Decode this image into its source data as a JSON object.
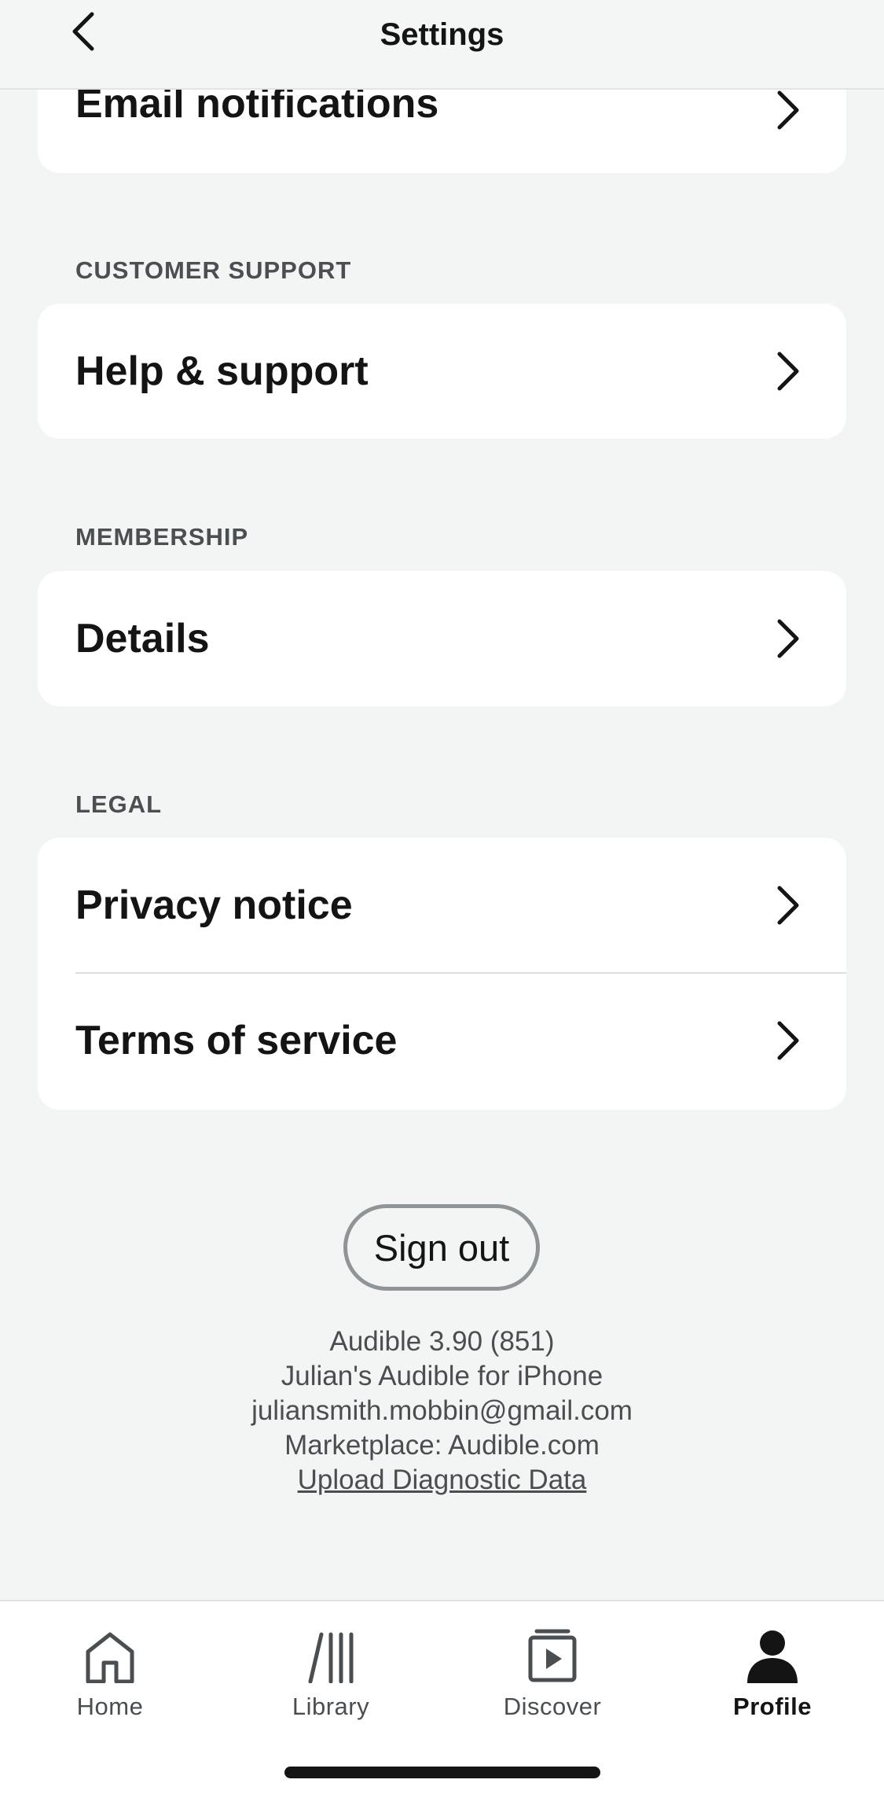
{
  "header": {
    "title": "Settings",
    "back_icon": "chevron-left-icon"
  },
  "sections": {
    "notifications": {
      "email_label": "Email notifications"
    },
    "customer_support": {
      "heading": "CUSTOMER SUPPORT",
      "help_label": "Help & support"
    },
    "membership": {
      "heading": "MEMBERSHIP",
      "details_label": "Details"
    },
    "legal": {
      "heading": "LEGAL",
      "privacy_label": "Privacy notice",
      "terms_label": "Terms of service"
    }
  },
  "signout_label": "Sign out",
  "app_info": {
    "version": "Audible 3.90 (851)",
    "device_name": "Julian's Audible for iPhone",
    "email": "juliansmith.mobbin@gmail.com",
    "marketplace": "Marketplace: Audible.com",
    "upload_link": "Upload Diagnostic Data"
  },
  "tabs": [
    {
      "label": "Home",
      "icon": "home-icon"
    },
    {
      "label": "Library",
      "icon": "library-icon"
    },
    {
      "label": "Discover",
      "icon": "discover-play-icon"
    },
    {
      "label": "Profile",
      "icon": "profile-icon",
      "active": true
    }
  ],
  "colors": {
    "background": "#f3f5f5",
    "card": "#ffffff",
    "text": "#141414",
    "muted": "#4a4e51"
  }
}
